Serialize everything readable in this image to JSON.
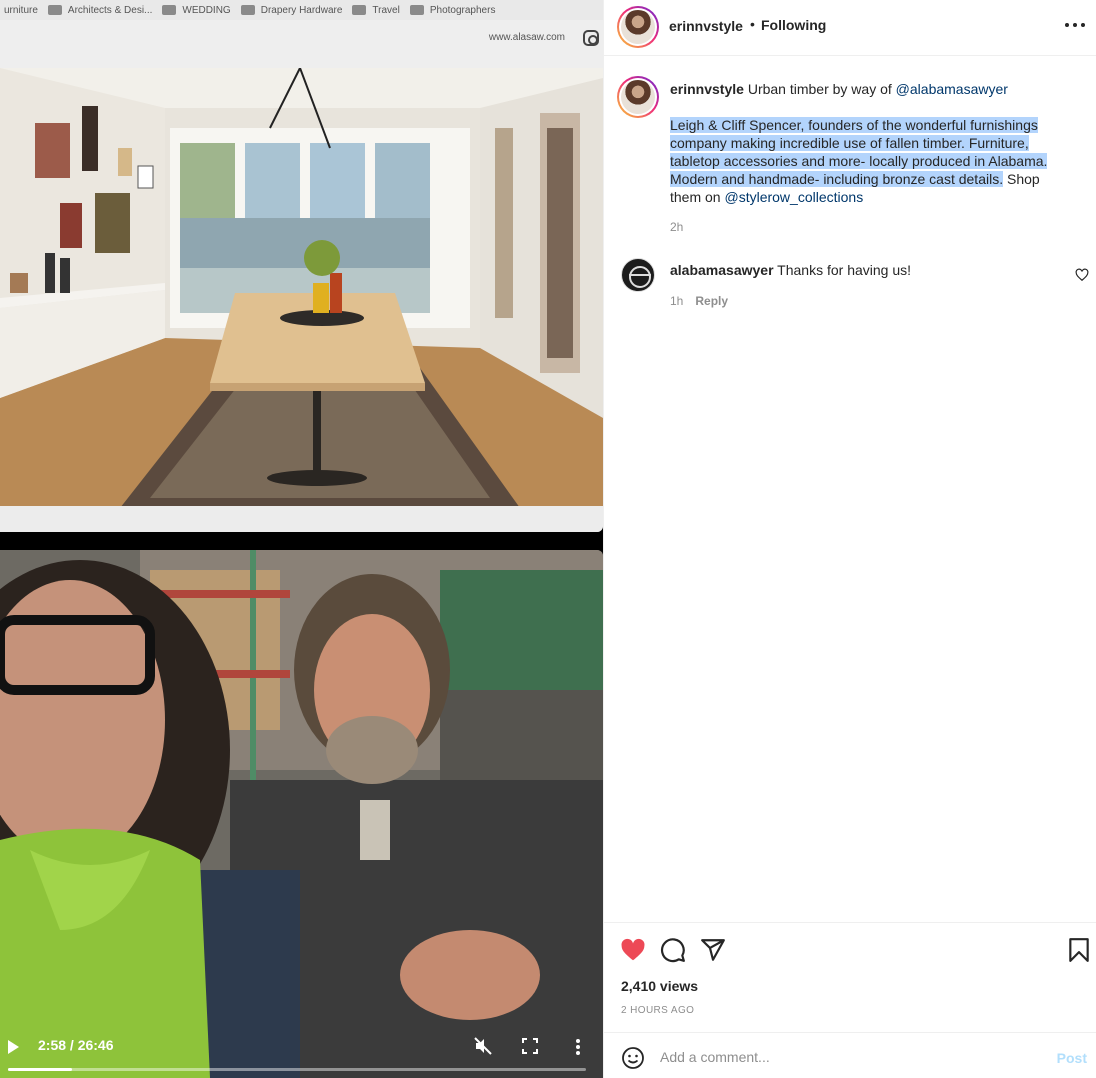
{
  "media": {
    "bookmarks": [
      "urniture",
      "Architects & Desi...",
      "WEDDING",
      "Drapery Hardware",
      "Travel",
      "Photographers"
    ],
    "site_url": "www.alasaw.com",
    "video": {
      "time": "2:58 / 26:46",
      "progress": 0.111
    }
  },
  "header": {
    "username": "erinnvstyle",
    "separator": "•",
    "follow_status": "Following"
  },
  "caption": {
    "username": "erinnvstyle",
    "lead_text": "Urban timber by way of",
    "lead_mention": "@alabamasawyer",
    "highlighted": "Leigh & Cliff Spencer, founders of the wonderful furnishings company making incredible use of fallen timber. Furniture, tabletop accessories and more- locally produced in Alabama. Modern and handmade- including bronze cast details.",
    "tail_text": "Shop them on",
    "tail_mention": "@stylerow_collections",
    "time": "2h"
  },
  "comment": {
    "username": "alabamasawyer",
    "text": "Thanks for having us!",
    "time": "1h",
    "reply_label": "Reply"
  },
  "stats": {
    "views": "2,410 views",
    "ago": "2 HOURS AGO"
  },
  "compose": {
    "placeholder": "Add a comment...",
    "post_label": "Post"
  },
  "colors": {
    "like": "#ed4956",
    "link": "#00376b",
    "selection": "#b3d4fc",
    "post_disabled": "#b2dffc"
  }
}
